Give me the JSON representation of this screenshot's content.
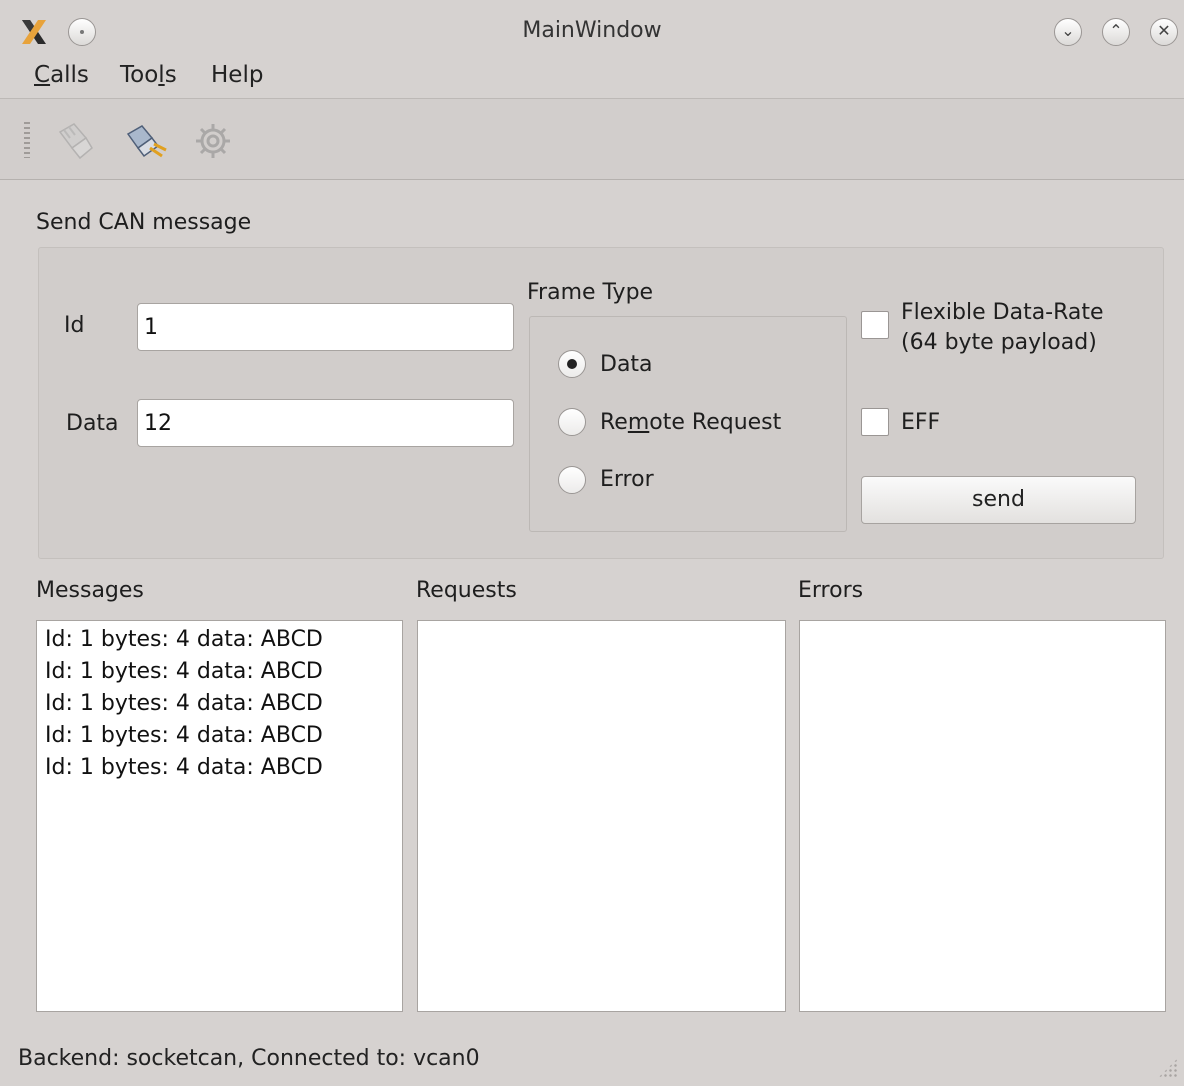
{
  "window": {
    "title": "MainWindow"
  },
  "menubar": {
    "items": [
      {
        "label": "Calls",
        "mnemonic": "C",
        "rest": "alls"
      },
      {
        "label": "Tools",
        "pre": "Too",
        "mnemonic": "l",
        "rest": "s"
      },
      {
        "label": "Help"
      }
    ]
  },
  "toolbar": {
    "icons": [
      "connect-icon",
      "disconnect-icon",
      "settings-gear-icon"
    ]
  },
  "send_group": {
    "title": "Send CAN message",
    "id_label": "Id",
    "id_value": "1",
    "data_label": "Data",
    "data_value": "12",
    "frame_type": {
      "title": "Frame Type",
      "options": [
        {
          "label": "Data",
          "selected": true
        },
        {
          "label": "Remote Request",
          "pre": "Re",
          "mnemonic": "m",
          "rest": "ote Request",
          "selected": false
        },
        {
          "label": "Error",
          "selected": false
        }
      ]
    },
    "fd_label_line1": "Flexible Data-Rate",
    "fd_label_line2": "(64 byte payload)",
    "fd_checked": false,
    "eff_label": "EFF",
    "eff_checked": false,
    "send_label": "send"
  },
  "panels": {
    "messages": {
      "title": "Messages",
      "items": [
        "Id: 1 bytes: 4 data: ABCD",
        "Id: 1 bytes: 4 data: ABCD",
        "Id: 1 bytes: 4 data: ABCD",
        "Id: 1 bytes: 4 data: ABCD",
        "Id: 1 bytes: 4 data: ABCD"
      ]
    },
    "requests": {
      "title": "Requests",
      "items": []
    },
    "errors": {
      "title": "Errors",
      "items": []
    }
  },
  "status_bar": {
    "text": "Backend: socketcan, Connected to: vcan0"
  },
  "colors": {
    "window_bg": "#d6d2d0",
    "field_bg": "#ffffff"
  }
}
